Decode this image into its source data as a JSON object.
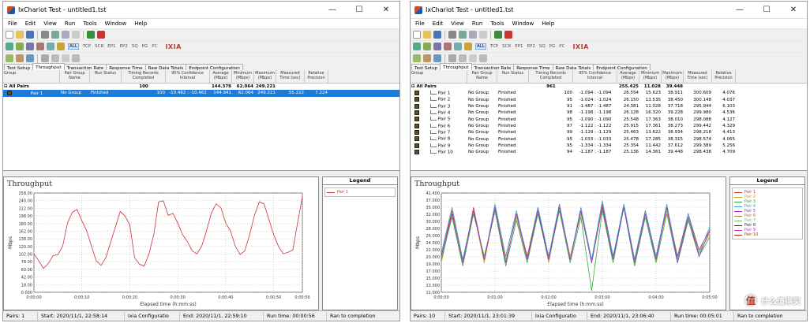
{
  "windows": [
    {
      "title": "IxChariot Test - untitled1.tst",
      "menu": [
        "File",
        "Edit",
        "View",
        "Run",
        "Tools",
        "Window",
        "Help"
      ],
      "protocols": [
        "ALL",
        "TCP",
        "SCR",
        "EP1",
        "EP2",
        "SQ",
        "PG",
        "PC"
      ],
      "brand": "IXIA",
      "tabs": [
        "Test Setup",
        "Throughput",
        "Transaction Rate",
        "Response Time",
        "Raw Data Totals",
        "Endpoint Configuration"
      ],
      "active_tab": 1,
      "columns": [
        "Group",
        "Pair Group Name",
        "Run Status",
        "Timing Records Completed",
        "95% Confidence Interval",
        "Average (Mbps)",
        "Minimum (Mbps)",
        "Maximum (Mbps)",
        "Measured Time (sec)",
        "Relative Precision"
      ],
      "all_pairs": {
        "label": "All Pairs",
        "records": "100",
        "average": "144.378",
        "minimum": "62.064",
        "maximum": "249.221"
      },
      "rows": [
        {
          "pair": "Pair 1",
          "group": "No Group",
          "status": "Finished",
          "records": "100",
          "ci": "-10.462 : -10.462",
          "average": "144.941",
          "minimum": "62.064",
          "maximum": "249.221",
          "time": "55.222",
          "precision": "7.224"
        }
      ],
      "chart_title": "Throughput",
      "legend_title": "Legend",
      "legend_items": [
        {
          "name": "Pair 1",
          "color": "#cc3333"
        }
      ],
      "status": [
        "Pairs: 1",
        "Start: 2020/11/1, 22:58:14",
        "Ixia Configuratio",
        "End: 2020/11/1, 22:59:10",
        "Run time: 00:00:56",
        "Ran to completion"
      ]
    },
    {
      "title": "IxChariot Test - untitled1.tst",
      "menu": [
        "File",
        "Edit",
        "View",
        "Run",
        "Tools",
        "Window",
        "Help"
      ],
      "protocols": [
        "ALL",
        "TCP",
        "SCR",
        "EP1",
        "EP2",
        "SQ",
        "PG",
        "PC"
      ],
      "brand": "IXIA",
      "tabs": [
        "Test Setup",
        "Throughput",
        "Transaction Rate",
        "Response Time",
        "Raw Data Totals",
        "Endpoint Configuration"
      ],
      "active_tab": 1,
      "columns": [
        "Group",
        "Pair Group Name",
        "Run Status",
        "Timing Records Completed",
        "95% Confidence Interval",
        "Average (Mbps)",
        "Minimum (Mbps)",
        "Maximum (Mbps)",
        "Measured Time (sec)",
        "Relative Precision"
      ],
      "all_pairs": {
        "label": "All Pairs",
        "records": "961",
        "average": "255.425",
        "minimum": "11.028",
        "maximum": "39.448"
      },
      "rows": [
        {
          "pair": "Pair 1",
          "group": "No Group",
          "status": "Finished",
          "records": "100",
          "ci": "-1.094 : -1.094",
          "average": "26.554",
          "minimum": "15.623",
          "maximum": "38.911",
          "time": "300.609",
          "precision": "4.076"
        },
        {
          "pair": "Pair 2",
          "group": "No Group",
          "status": "Finished",
          "records": "95",
          "ci": "-1.024 : -1.024",
          "average": "26.150",
          "minimum": "13.535",
          "maximum": "38.450",
          "time": "300.148",
          "precision": "4.037"
        },
        {
          "pair": "Pair 3",
          "group": "No Group",
          "status": "Finished",
          "records": "91",
          "ci": "-1.487 : -1.487",
          "average": "24.381",
          "minimum": "11.028",
          "maximum": "37.718",
          "time": "295.944",
          "precision": "6.103"
        },
        {
          "pair": "Pair 4",
          "group": "No Group",
          "status": "Finished",
          "records": "98",
          "ci": "-1.198 : -1.198",
          "average": "26.128",
          "minimum": "16.320",
          "maximum": "39.228",
          "time": "299.980",
          "precision": "4.536"
        },
        {
          "pair": "Pair 5",
          "group": "No Group",
          "status": "Finished",
          "records": "95",
          "ci": "-1.090 : -1.090",
          "average": "25.548",
          "minimum": "17.363",
          "maximum": "38.010",
          "time": "298.088",
          "precision": "4.127"
        },
        {
          "pair": "Pair 6",
          "group": "No Group",
          "status": "Finished",
          "records": "97",
          "ci": "-1.122 : -1.122",
          "average": "25.915",
          "minimum": "17.361",
          "maximum": "38.273",
          "time": "299.442",
          "precision": "4.329"
        },
        {
          "pair": "Pair 7",
          "group": "No Group",
          "status": "Finished",
          "records": "99",
          "ci": "-1.129 : -1.129",
          "average": "25.463",
          "minimum": "13.622",
          "maximum": "38.934",
          "time": "298.218",
          "precision": "4.413"
        },
        {
          "pair": "Pair 8",
          "group": "No Group",
          "status": "Finished",
          "records": "95",
          "ci": "-1.033 : -1.033",
          "average": "25.478",
          "minimum": "17.285",
          "maximum": "38.315",
          "time": "298.574",
          "precision": "4.065"
        },
        {
          "pair": "Pair 9",
          "group": "No Group",
          "status": "Finished",
          "records": "95",
          "ci": "-1.334 : -1.334",
          "average": "25.354",
          "minimum": "11.442",
          "maximum": "37.612",
          "time": "299.389",
          "precision": "5.256"
        },
        {
          "pair": "Pair 10",
          "group": "No Group",
          "status": "Finished",
          "records": "94",
          "ci": "-1.187 : -1.187",
          "average": "25.136",
          "minimum": "14.361",
          "maximum": "39.448",
          "time": "298.438",
          "precision": "4.709"
        }
      ],
      "chart_title": "Throughput",
      "legend_title": "Legend",
      "legend_items": [
        {
          "name": "Pair 1",
          "color": "#cc3333"
        },
        {
          "name": "Pair 2",
          "color": "#d4a017"
        },
        {
          "name": "Pair 3",
          "color": "#33aa33"
        },
        {
          "name": "Pair 4",
          "color": "#3399cc"
        },
        {
          "name": "Pair 5",
          "color": "#9933cc"
        },
        {
          "name": "Pair 6",
          "color": "#aa7733"
        },
        {
          "name": "Pair 7",
          "color": "#66cc66"
        },
        {
          "name": "Pair 8",
          "color": "#333333"
        },
        {
          "name": "Pair 9",
          "color": "#cc33cc"
        },
        {
          "name": "Pair 10",
          "color": "#aa3300"
        }
      ],
      "status": [
        "Pairs: 10",
        "Start: 2020/11/1, 23:01:39",
        "Ixia Configuratio",
        "End: 2020/11/1, 23:06:40",
        "Run time: 00:05:01",
        "Ran to completion"
      ]
    }
  ],
  "watermark": "什么值得买",
  "colors": {
    "selection": "#1e7bd8",
    "chart_line": "#cc3333",
    "brand": "#c0392b"
  },
  "chart_data": [
    {
      "type": "line",
      "title": "Throughput",
      "xlabel": "Elapsed time (h:mm:ss)",
      "ylabel": "Mbps",
      "x_ticks": [
        "0:00:00",
        "0:00:10",
        "0:00:20",
        "0:00:30",
        "0:00:40",
        "0:00:50",
        "0:00:56"
      ],
      "x_range": [
        0,
        56
      ],
      "y_ticks": [
        "0.000",
        "18.00",
        "42.00",
        "60.00",
        "78.00",
        "102.00",
        "120.00",
        "138.00",
        "162.00",
        "180.00",
        "198.00",
        "222.00",
        "240.00",
        "258.00"
      ],
      "ylim": [
        0,
        258
      ],
      "series": [
        {
          "name": "Pair 1",
          "x": [
            0,
            1,
            2,
            3,
            4,
            5,
            6,
            7,
            8,
            9,
            10,
            11,
            12,
            13,
            14,
            15,
            16,
            17,
            18,
            19,
            20,
            21,
            22,
            23,
            24,
            25,
            26,
            27,
            28,
            29,
            30,
            31,
            32,
            33,
            34,
            35,
            36,
            37,
            38,
            39,
            40,
            41,
            42,
            43,
            44,
            45,
            46,
            47,
            48,
            49,
            50,
            51,
            52,
            53,
            54,
            55,
            56
          ],
          "y": [
            100,
            82,
            62,
            75,
            95,
            98,
            120,
            180,
            208,
            215,
            186,
            160,
            120,
            82,
            70,
            90,
            130,
            170,
            210,
            198,
            175,
            90,
            73,
            68,
            100,
            150,
            235,
            238,
            200,
            205,
            180,
            150,
            132,
            108,
            100,
            120,
            160,
            205,
            230,
            220,
            180,
            160,
            120,
            98,
            108,
            150,
            200,
            235,
            230,
            190,
            150,
            120,
            100,
            104,
            110,
            180,
            248
          ]
        }
      ]
    },
    {
      "type": "line",
      "title": "Throughput",
      "xlabel": "Elapsed time (h:mm:ss)",
      "ylabel": "Mbps",
      "x_ticks": [
        "0:00:00",
        "0:01:00",
        "0:02:00",
        "0:03:00",
        "0:04:00",
        "0:05:00"
      ],
      "x_range": [
        0,
        300
      ],
      "y_ticks": [
        "11.000",
        "13.000",
        "15.000",
        "17.000",
        "19.000",
        "20.000",
        "22.000",
        "24.000",
        "26.000",
        "28.000",
        "30.000",
        "32.000",
        "35.000",
        "37.000",
        "41.400"
      ],
      "ylim": [
        11,
        41.4
      ],
      "series_summary": "10 overlapping series (Pair 1 - Pair 10) oscillating between ~15 and ~39 Mbps with a period of roughly 12 seconds",
      "series": [
        {
          "name": "Pair 1",
          "x": [
            0,
            12,
            24,
            36,
            48,
            60,
            72,
            84,
            96,
            108,
            120,
            132,
            144,
            156,
            168,
            180,
            192,
            204,
            216,
            228,
            240,
            252,
            264,
            276,
            288,
            300
          ],
          "y": [
            22,
            36,
            20,
            37,
            21,
            36,
            20,
            35,
            22,
            37,
            21,
            38,
            21,
            36,
            20,
            38,
            22,
            37,
            21,
            36,
            21,
            37,
            22,
            35,
            24,
            30
          ]
        },
        {
          "name": "Pair 2",
          "x": [
            0,
            12,
            24,
            36,
            48,
            60,
            72,
            84,
            96,
            108,
            120,
            132,
            144,
            156,
            168,
            180,
            192,
            204,
            216,
            228,
            240,
            252,
            264,
            276,
            288,
            300
          ],
          "y": [
            20,
            35,
            21,
            36,
            20,
            37,
            21,
            34,
            21,
            36,
            20,
            37,
            22,
            35,
            21,
            37,
            21,
            38,
            20,
            35,
            22,
            36,
            21,
            34,
            23,
            29
          ]
        },
        {
          "name": "Pair 3",
          "x": [
            0,
            12,
            24,
            36,
            48,
            60,
            72,
            84,
            96,
            108,
            120,
            132,
            144,
            156,
            168,
            180,
            192,
            204,
            216,
            228,
            240,
            252,
            264,
            276,
            288,
            300
          ],
          "y": [
            21,
            34,
            19,
            35,
            22,
            36,
            19,
            33,
            20,
            35,
            21,
            36,
            20,
            34,
            11.5,
            36,
            20,
            37,
            19,
            34,
            20,
            35,
            20,
            33,
            22,
            28
          ]
        },
        {
          "name": "Pair 4",
          "x": [
            0,
            12,
            24,
            36,
            48,
            60,
            72,
            84,
            96,
            108,
            120,
            132,
            144,
            156,
            168,
            180,
            192,
            204,
            216,
            228,
            240,
            252,
            264,
            276,
            288,
            300
          ],
          "y": [
            23,
            37,
            21,
            36,
            21,
            38,
            22,
            36,
            21,
            37,
            22,
            38,
            21,
            37,
            21,
            39,
            22,
            38,
            21,
            36,
            22,
            38,
            21,
            35,
            23,
            31
          ]
        },
        {
          "name": "Pair 5",
          "x": [
            0,
            12,
            24,
            36,
            48,
            60,
            72,
            84,
            96,
            108,
            120,
            132,
            144,
            156,
            168,
            180,
            192,
            204,
            216,
            228,
            240,
            252,
            264,
            276,
            288,
            300
          ],
          "y": [
            22,
            35,
            20,
            36,
            21,
            37,
            20,
            35,
            21,
            36,
            21,
            37,
            21,
            36,
            20,
            37,
            21,
            37,
            20,
            35,
            21,
            37,
            20,
            34,
            22,
            30
          ]
        }
      ]
    }
  ]
}
